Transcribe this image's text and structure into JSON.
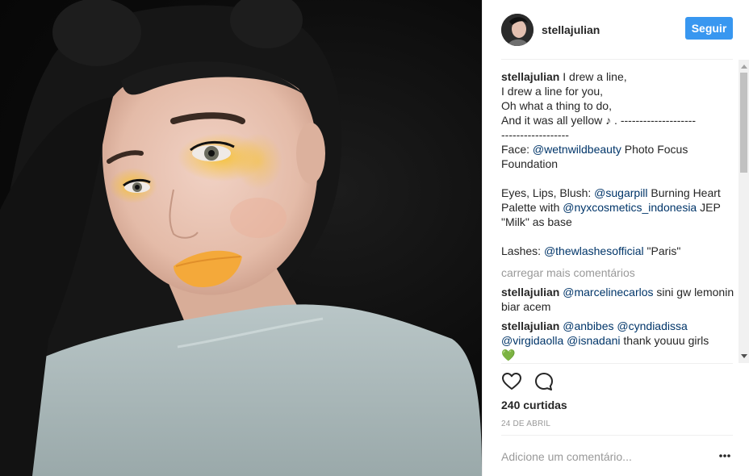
{
  "post": {
    "username": "stellajulian",
    "follow_label": "Seguir",
    "caption_lines": [
      "I drew a line,",
      "I drew a line for you,",
      "Oh what a thing to do,",
      "And it was all yellow ♪ . --------------------",
      "------------------"
    ],
    "face_label": "Face: ",
    "face_mention": "@wetnwildbeauty",
    "face_text": " Photo Focus Foundation",
    "eyes_label": "Eyes, Lips, Blush: ",
    "eyes_mention1": "@sugarpill",
    "eyes_text1": " Burning Heart Palette with ",
    "eyes_mention2": "@nyxcosmetics_indonesia",
    "eyes_text2": " JEP \"Milk\" as base",
    "lashes_label": "Lashes: ",
    "lashes_mention": "@thewlashesofficial",
    "lashes_text": " \"Paris\"",
    "load_more": "carregar mais comentários",
    "comments": [
      {
        "user": "stellajulian",
        "mention": "@marcelinecarlos",
        "text": " sini gw lemonin biar acem"
      },
      {
        "user": "stellajulian",
        "mention1": "@anbibes",
        "mention2": "@cyndiadissa",
        "mention3": "@virgidaolla",
        "mention4": "@isnadani",
        "text": " thank youuu girls",
        "emoji": "💚"
      }
    ],
    "likes": "240 curtidas",
    "date": "24 DE ABRIL",
    "comment_placeholder": "Adicione um comentário..."
  },
  "icons": {
    "like": "heart-icon",
    "comment": "comment-icon",
    "more": "more-options-icon"
  },
  "colors": {
    "follow_button": "#3897f0",
    "mention": "#003569",
    "muted": "#999999"
  }
}
